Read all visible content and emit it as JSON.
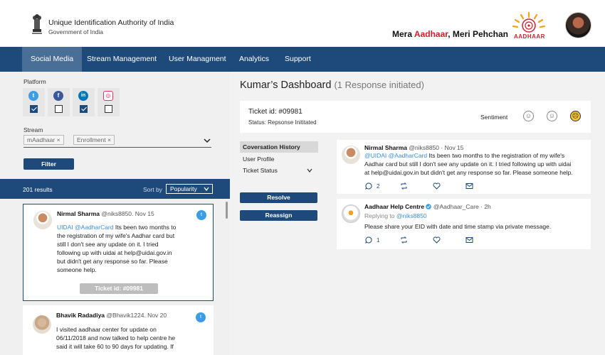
{
  "header": {
    "org_name": "Unique Identification Authority of India",
    "org_sub": "Government of India",
    "slogan_a": "Mera ",
    "slogan_b": "Aadhaar",
    "slogan_c": ", Meri Pehchan",
    "logo_text": "AADHAAR"
  },
  "nav": [
    {
      "label": "Social Media",
      "active": true
    },
    {
      "label": "Stream Management"
    },
    {
      "label": "User Managment"
    },
    {
      "label": "Analytics"
    },
    {
      "label": "Support"
    }
  ],
  "filters": {
    "platform_label": "Platform",
    "platforms": [
      {
        "icon": "twitter-icon",
        "glyph": "t",
        "color": "#3a9de6",
        "checked": true
      },
      {
        "icon": "facebook-icon",
        "glyph": "f",
        "color": "#3b5998",
        "checked": false
      },
      {
        "icon": "linkedin-icon",
        "glyph": "in",
        "color": "#0077b5",
        "checked": true
      },
      {
        "icon": "instagram-icon",
        "glyph": "◎",
        "color": "#e1306c",
        "checked": false
      }
    ],
    "stream_label": "Stream",
    "chips": [
      "mAadhaar ×",
      "Enrollment ×"
    ],
    "filter_button": "Filter"
  },
  "results": {
    "count": "201 results",
    "sort_label": "Sort by",
    "sort_value": "Popularity"
  },
  "cards": [
    {
      "name": "Nirmal Sharma",
      "handle": "@niks8850. Nov 15",
      "mentions": "UIDAI @AadharCard",
      "text_l1": " Its been two months to",
      "lines": [
        "the registration of my wife's Aadhar card but",
        "still I don't see any update on it. I tried",
        "following up with uidai at help@uidai.gov.in",
        "but didn't get any response so far. Please",
        "someone help."
      ],
      "ticket": "Ticket id: #09981"
    },
    {
      "name": "Bhavik Radadiya",
      "handle": "@Bhavik1224. Nov 20",
      "lines": [
        "I visited aadhaar center for update on",
        "06/11/2018 and now talked to help centre he",
        "said it will take 60 to 90 days for updating. If"
      ]
    }
  ],
  "dashboard": {
    "title": "Kumar’s Dashboard",
    "subtitle": "(1 Response initiated)",
    "ticket_id": "Ticket id: #09981",
    "status": "Status: Repsonse Inititated",
    "sentiment_label": "Sentiment"
  },
  "history_menu": [
    {
      "label": "Coversation History",
      "active": true
    },
    {
      "label": "User Profile"
    },
    {
      "label": "Ticket Status",
      "chevron": true
    }
  ],
  "actions": {
    "resolve": "Resolve",
    "reassign": "Reassign"
  },
  "responses": [
    {
      "name": "Nirmal Sharma",
      "handle": "@niks8850 · Nov 15",
      "mentions": "@UIDAI @AadharCard",
      "text_l1": " Its been two months to the registration of my wife's",
      "lines": [
        "Aadhar card but still I don't see any update on it. I tried following up with uidai",
        "at help@uidai.gov.in but didn't get any response so far. Please someone help."
      ],
      "reply_count": "2"
    },
    {
      "name": "Aadhaar Help Centre",
      "handle": "@Aadhaar_Care · 2h",
      "replying_prefix": "Replying to ",
      "replying_to": "@niks8850",
      "lines": [
        "Please share your EID with date and time stamp via private message."
      ],
      "reply_count": "1"
    }
  ]
}
